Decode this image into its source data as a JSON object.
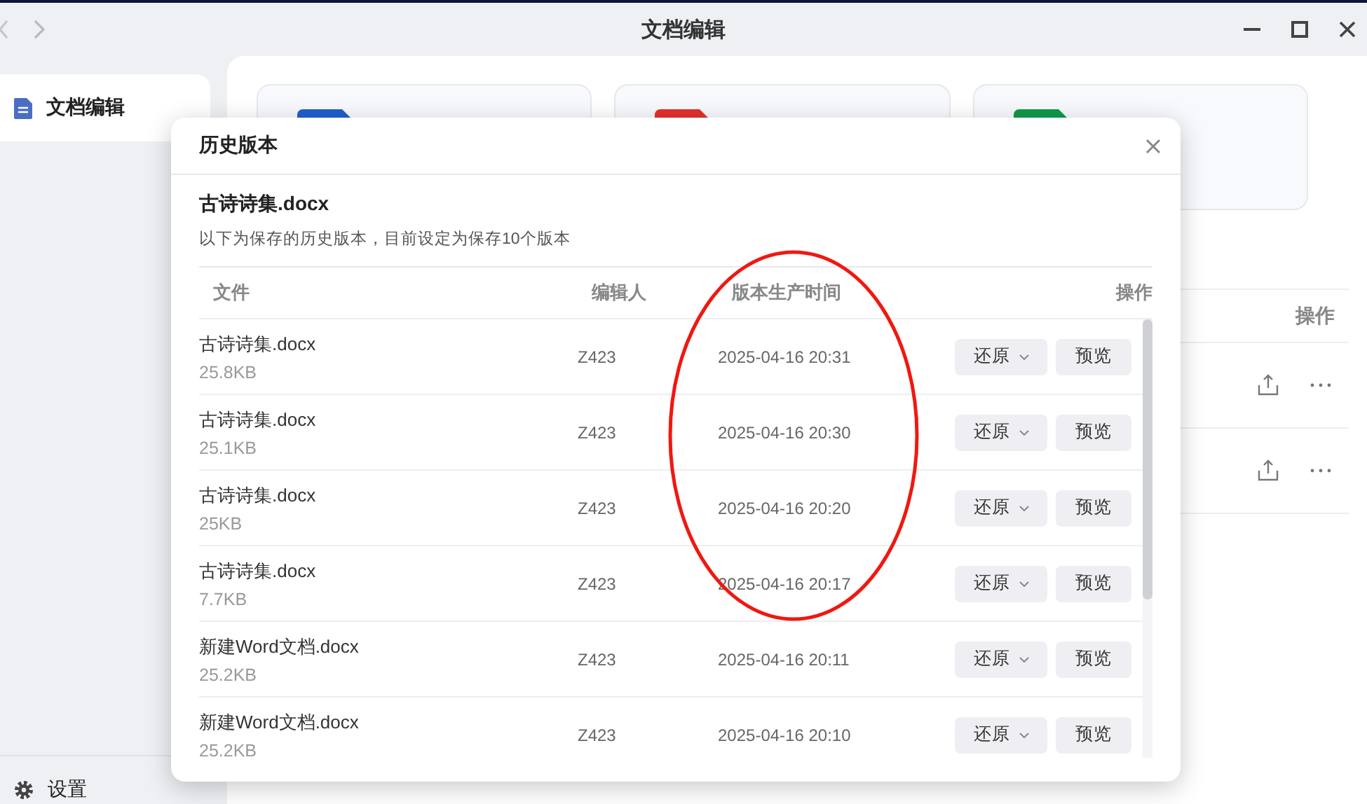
{
  "window": {
    "title": "文档编辑"
  },
  "sidebar": {
    "items": [
      {
        "label": "文档编辑",
        "selected": true
      }
    ],
    "footer": {
      "label": "设置"
    }
  },
  "cards": [
    {
      "kind": "word"
    },
    {
      "kind": "pdf"
    },
    {
      "kind": "sheet"
    }
  ],
  "file_table": {
    "columns": [
      {
        "label": "操作"
      }
    ],
    "rows": [
      {
        "kind": "file"
      },
      {
        "kind": "file"
      }
    ]
  },
  "dialog": {
    "title": "历史版本",
    "file_name": "古诗诗集.docx",
    "description": "以下为保存的历史版本，目前设定为保存10个版本",
    "columns": [
      "文件",
      "编辑人",
      "版本生产时间",
      "操作"
    ],
    "rows": [
      {
        "file": "古诗诗集.docx",
        "size": "25.8KB",
        "editor": "Z423",
        "time": "2025-04-16 20:31",
        "restore": "还原",
        "preview": "预览"
      },
      {
        "file": "古诗诗集.docx",
        "size": "25.1KB",
        "editor": "Z423",
        "time": "2025-04-16 20:30",
        "restore": "还原",
        "preview": "预览"
      },
      {
        "file": "古诗诗集.docx",
        "size": "25KB",
        "editor": "Z423",
        "time": "2025-04-16 20:20",
        "restore": "还原",
        "preview": "预览"
      },
      {
        "file": "古诗诗集.docx",
        "size": "7.7KB",
        "editor": "Z423",
        "time": "2025-04-16 20:17",
        "restore": "还原",
        "preview": "预览"
      },
      {
        "file": "新建Word文档.docx",
        "size": "25.2KB",
        "editor": "Z423",
        "time": "2025-04-16 20:11",
        "restore": "还原",
        "preview": "预览"
      },
      {
        "file": "新建Word文档.docx",
        "size": "25.2KB",
        "editor": "Z423",
        "time": "2025-04-16 20:10",
        "restore": "还原",
        "preview": "预览"
      }
    ]
  },
  "annotation": {
    "kind": "ellipse"
  }
}
